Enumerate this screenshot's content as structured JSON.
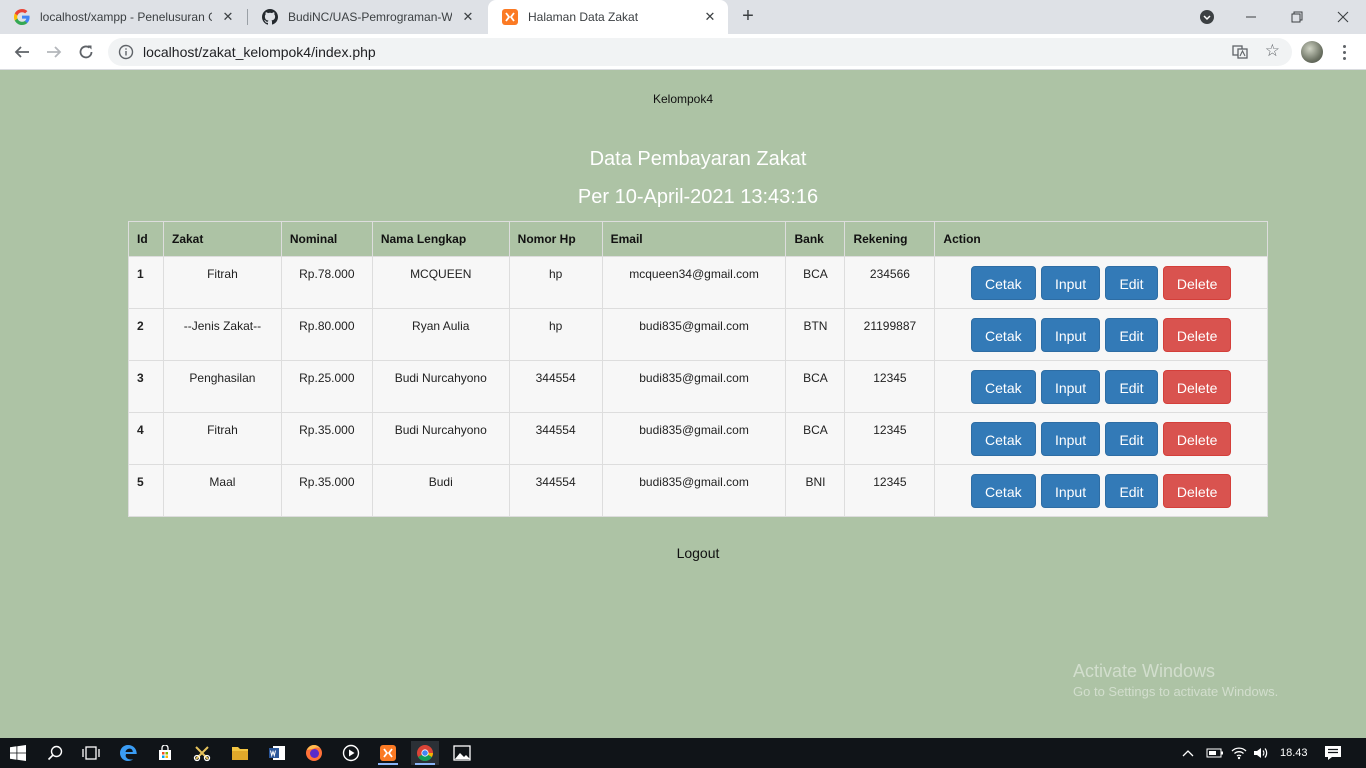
{
  "browser": {
    "tabs": [
      {
        "title": "localhost/xampp - Penelusuran G",
        "icon": "google-icon",
        "active": false
      },
      {
        "title": "BudiNC/UAS-Pemrograman-Web",
        "icon": "github-icon",
        "active": false
      },
      {
        "title": "Halaman Data Zakat",
        "icon": "xampp-icon",
        "active": true
      }
    ],
    "url": "localhost/zakat_kelompok4/index.php"
  },
  "page": {
    "brand": "Kelompok4",
    "title": "Data Pembayaran Zakat",
    "subtitle": "Per 10-April-2021 13:43:16",
    "logout_label": "Logout"
  },
  "table": {
    "headers": [
      "Id",
      "Zakat",
      "Nominal",
      "Nama Lengkap",
      "Nomor Hp",
      "Email",
      "Bank",
      "Rekening",
      "Action"
    ],
    "rows": [
      {
        "id": "1",
        "zakat": "Fitrah",
        "nominal": "Rp.78.000",
        "nama": "MCQUEEN",
        "hp": "hp",
        "email": "mcqueen34@gmail.com",
        "bank": "BCA",
        "rekening": "234566"
      },
      {
        "id": "2",
        "zakat": "--Jenis Zakat--",
        "nominal": "Rp.80.000",
        "nama": "Ryan Aulia",
        "hp": "hp",
        "email": "budi835@gmail.com",
        "bank": "BTN",
        "rekening": "21199887"
      },
      {
        "id": "3",
        "zakat": "Penghasilan",
        "nominal": "Rp.25.000",
        "nama": "Budi Nurcahyono",
        "hp": "344554",
        "email": "budi835@gmail.com",
        "bank": "BCA",
        "rekening": "12345"
      },
      {
        "id": "4",
        "zakat": "Fitrah",
        "nominal": "Rp.35.000",
        "nama": "Budi Nurcahyono",
        "hp": "344554",
        "email": "budi835@gmail.com",
        "bank": "BCA",
        "rekening": "12345"
      },
      {
        "id": "5",
        "zakat": "Maal",
        "nominal": "Rp.35.000",
        "nama": "Budi",
        "hp": "344554",
        "email": "budi835@gmail.com",
        "bank": "BNI",
        "rekening": "12345"
      }
    ],
    "actions": {
      "cetak": "Cetak",
      "input": "Input",
      "edit": "Edit",
      "delete": "Delete"
    }
  },
  "watermark": {
    "line1": "Activate Windows",
    "line2": "Go to Settings to activate Windows."
  },
  "taskbar": {
    "clock": "18.43"
  },
  "colors": {
    "page_bg": "#adc3a5",
    "primary": "#337ab7",
    "danger": "#d9534f"
  }
}
